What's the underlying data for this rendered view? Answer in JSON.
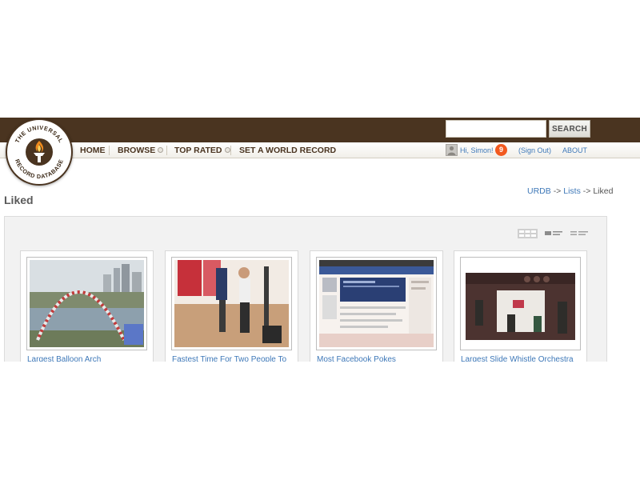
{
  "header": {
    "search": {
      "value": "",
      "placeholder": "",
      "button_label": "SEARCH"
    },
    "logo": {
      "text": "THE UNIVERSAL RECORD DATABASE",
      "icon": "torch-icon"
    }
  },
  "nav": {
    "items": [
      {
        "label": "HOME",
        "has_caret": false
      },
      {
        "label": "BROWSE",
        "has_caret": true
      },
      {
        "label": "TOP RATED",
        "has_caret": true
      },
      {
        "label": "SET A WORLD RECORD",
        "has_caret": false
      }
    ]
  },
  "user": {
    "greeting": "Hi, Simon!",
    "notification_count": "9",
    "sign_out": "(Sign Out)",
    "about": "ABOUT"
  },
  "page": {
    "title": "Liked",
    "breadcrumb": {
      "root": "URDB",
      "sep": "->",
      "lists": "Lists",
      "current": "Liked"
    }
  },
  "view_toggle": [
    "grid-view-icon",
    "list-view-icon",
    "compact-list-view-icon"
  ],
  "records": [
    {
      "title": "Largest Balloon Arch"
    },
    {
      "title": "Fastest Time For Two People To"
    },
    {
      "title": "Most Facebook Pokes"
    },
    {
      "title": "Largest Slide Whistle Orchestra"
    }
  ],
  "colors": {
    "brand_brown": "#4a3420",
    "link_blue": "#3e78b8",
    "badge_orange": "#f2591f"
  }
}
